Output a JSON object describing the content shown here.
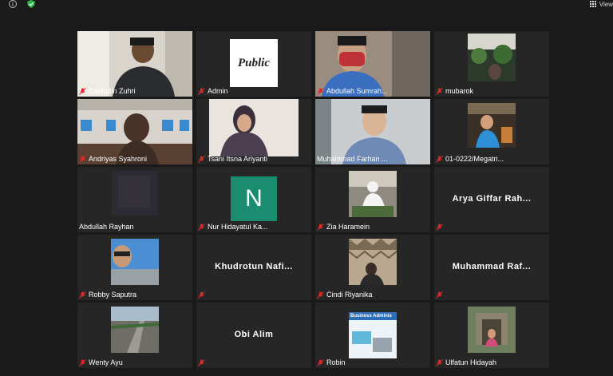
{
  "app": {
    "view_label": "View"
  },
  "participants": [
    {
      "name": "Saefudin Zuhri",
      "muted": true,
      "type": "video"
    },
    {
      "name": "Admin",
      "muted": true,
      "type": "logo",
      "logo_text": "Public"
    },
    {
      "name": "Abdullah Sumrah...",
      "muted": true,
      "type": "video"
    },
    {
      "name": "mubarok",
      "muted": true,
      "type": "video"
    },
    {
      "name": "Andriyas Syahroni",
      "muted": true,
      "type": "video"
    },
    {
      "name": "Tsani Itsna Ariyanti",
      "muted": true,
      "type": "video"
    },
    {
      "name": "Muhammad Farhan ...",
      "muted": false,
      "type": "video",
      "active": true
    },
    {
      "name": "01-0222/Megatri...",
      "muted": true,
      "type": "video"
    },
    {
      "name": "Abdullah Rayhan",
      "muted": false,
      "type": "video"
    },
    {
      "name": "Nur Hidayatul Ka...",
      "muted": true,
      "type": "avatar",
      "initial": "N"
    },
    {
      "name": "Zia Haramein",
      "muted": true,
      "type": "video"
    },
    {
      "name": "",
      "muted": true,
      "type": "name",
      "display_name": "Arya Giffar Rah..."
    },
    {
      "name": "Robby Saputra",
      "muted": true,
      "type": "video"
    },
    {
      "name": "",
      "muted": true,
      "type": "name",
      "display_name": "Khudrotun Nafi..."
    },
    {
      "name": "Cindi Riyanika",
      "muted": true,
      "type": "video"
    },
    {
      "name": "",
      "muted": true,
      "type": "name",
      "display_name": "Muhammad Raf..."
    },
    {
      "name": "Wenty Ayu",
      "muted": true,
      "type": "video"
    },
    {
      "name": "",
      "muted": true,
      "type": "name",
      "display_name": "Obi Alim"
    },
    {
      "name": "Robin",
      "muted": true,
      "type": "video",
      "sign_text": "Business Adminis"
    },
    {
      "name": "Ulfatun Hidayah",
      "muted": true,
      "type": "video"
    }
  ],
  "colors": {
    "background": "#1a1a1a",
    "tile": "#262626",
    "active_border": "#c7e23a",
    "mute_red": "#e02828"
  }
}
